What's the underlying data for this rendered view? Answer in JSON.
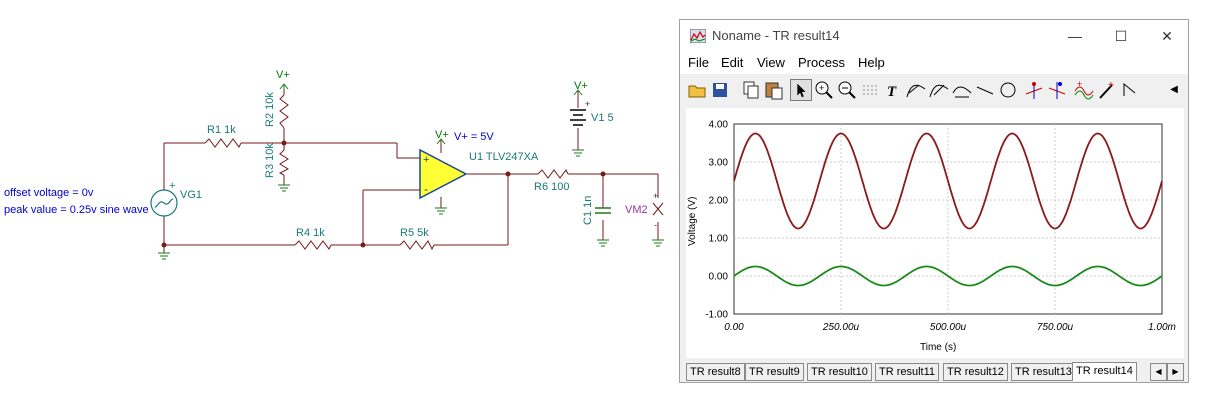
{
  "schematic": {
    "annotations": {
      "offset": "offset voltage = 0v",
      "peak": "peak value = 0.25v sine wave"
    },
    "components": {
      "vg1": "VG1",
      "r1": "R1 1k",
      "r2": "R2 10k",
      "r3": "R3 10k",
      "r4": "R4 1k",
      "r5": "R5 5k",
      "r6": "R6 100",
      "c1": "C1 1n",
      "u1": "U1 TLV247XA",
      "v1": "V1 5",
      "vm2": "VM2",
      "vplus_label": "V+",
      "vplus_value": "V+ = 5V"
    },
    "symbols": {
      "plus": "+",
      "minus": "-"
    }
  },
  "window": {
    "title": "Noname - TR result14",
    "controls": {
      "minimize": "—",
      "maximize": "☐",
      "close": "✕"
    },
    "menu": [
      "File",
      "Edit",
      "View",
      "Process",
      "Help"
    ],
    "toolbar_icons": [
      "open-icon",
      "save-icon",
      "copy-icon",
      "paste-icon",
      "pointer-icon",
      "zoom-in-icon",
      "zoom-out-icon",
      "grid-icon",
      "text-icon",
      "cursor-a-icon",
      "cursor-b-icon",
      "cursor-c-icon",
      "line-icon",
      "circle-icon",
      "marker-a-icon",
      "marker-b-icon",
      "wave-icon",
      "probe-icon",
      "step-icon",
      "scroll-left-icon"
    ],
    "tabs": [
      "TR result8",
      "TR result9",
      "TR result10",
      "TR result11",
      "TR result12",
      "TR result13",
      "TR result14"
    ],
    "active_tab": "TR result14",
    "tab_scroll": {
      "left": "◀",
      "right": "▶"
    }
  },
  "chart_data": {
    "type": "line",
    "xlabel": "Time (s)",
    "ylabel": "Voltage (V)",
    "xlim": [
      0,
      0.001
    ],
    "ylim": [
      -1,
      4
    ],
    "x_ticks": [
      "0.00",
      "250.00u",
      "500.00u",
      "750.00u",
      "1.00m"
    ],
    "y_ticks": [
      "4.00",
      "3.00",
      "2.00",
      "1.00",
      "0.00",
      "-1.00"
    ],
    "grid": true,
    "colors": {
      "output": "#8b1a1a",
      "input": "#1a8a1a"
    },
    "series": [
      {
        "offset": 2.5,
        "amplitude": 1.25,
        "frequency_hz": 5000,
        "phase_deg": 0,
        "color": "#8b1a1a"
      },
      {
        "offset": 0.0,
        "amplitude": 0.25,
        "frequency_hz": 5000,
        "phase_deg": 0,
        "color": "#1a8a1a"
      }
    ]
  }
}
